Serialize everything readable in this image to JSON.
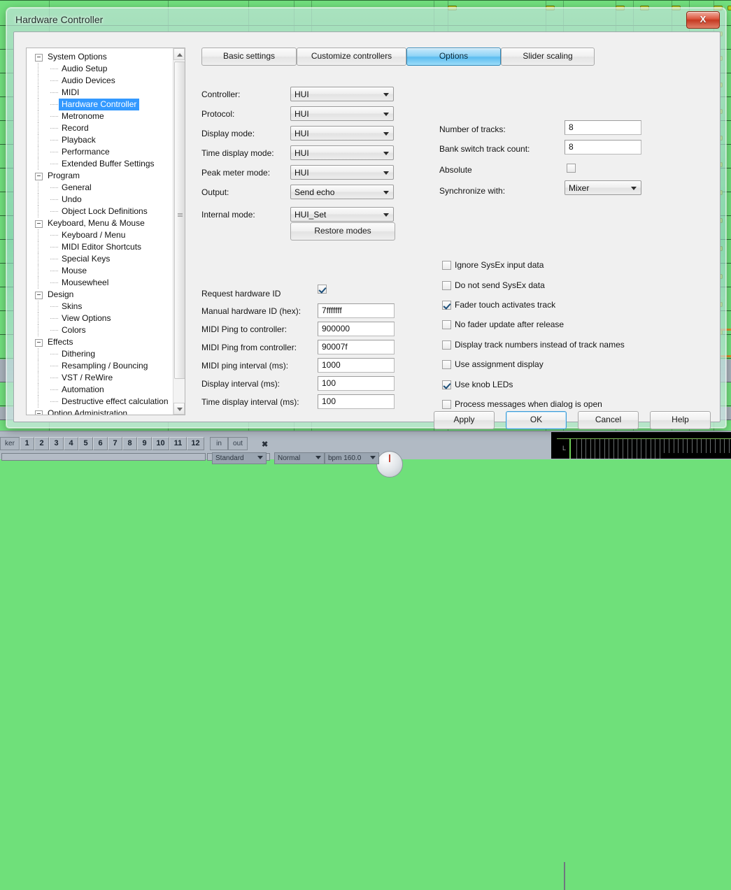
{
  "window": {
    "title": "Hardware Controller",
    "close_label": "X"
  },
  "tree": {
    "nodes": [
      {
        "label": "System Options",
        "level": 0,
        "expandable": true,
        "selected": false
      },
      {
        "label": "Audio Setup",
        "level": 1,
        "expandable": false,
        "selected": false
      },
      {
        "label": "Audio Devices",
        "level": 1,
        "expandable": false,
        "selected": false
      },
      {
        "label": "MIDI",
        "level": 1,
        "expandable": false,
        "selected": false
      },
      {
        "label": "Hardware Controller",
        "level": 1,
        "expandable": false,
        "selected": true
      },
      {
        "label": "Metronome",
        "level": 1,
        "expandable": false,
        "selected": false
      },
      {
        "label": "Record",
        "level": 1,
        "expandable": false,
        "selected": false
      },
      {
        "label": "Playback",
        "level": 1,
        "expandable": false,
        "selected": false
      },
      {
        "label": "Performance",
        "level": 1,
        "expandable": false,
        "selected": false
      },
      {
        "label": "Extended Buffer Settings",
        "level": 1,
        "expandable": false,
        "selected": false
      },
      {
        "label": "Program",
        "level": 0,
        "expandable": true,
        "selected": false
      },
      {
        "label": "General",
        "level": 1,
        "expandable": false,
        "selected": false
      },
      {
        "label": "Undo",
        "level": 1,
        "expandable": false,
        "selected": false
      },
      {
        "label": "Object Lock Definitions",
        "level": 1,
        "expandable": false,
        "selected": false
      },
      {
        "label": "Keyboard, Menu & Mouse",
        "level": 0,
        "expandable": true,
        "selected": false
      },
      {
        "label": "Keyboard / Menu",
        "level": 1,
        "expandable": false,
        "selected": false
      },
      {
        "label": "MIDI Editor Shortcuts",
        "level": 1,
        "expandable": false,
        "selected": false
      },
      {
        "label": "Special Keys",
        "level": 1,
        "expandable": false,
        "selected": false
      },
      {
        "label": "Mouse",
        "level": 1,
        "expandable": false,
        "selected": false
      },
      {
        "label": "Mousewheel",
        "level": 1,
        "expandable": false,
        "selected": false
      },
      {
        "label": "Design",
        "level": 0,
        "expandable": true,
        "selected": false
      },
      {
        "label": "Skins",
        "level": 1,
        "expandable": false,
        "selected": false
      },
      {
        "label": "View Options",
        "level": 1,
        "expandable": false,
        "selected": false
      },
      {
        "label": "Colors",
        "level": 1,
        "expandable": false,
        "selected": false
      },
      {
        "label": "Effects",
        "level": 0,
        "expandable": true,
        "selected": false
      },
      {
        "label": "Dithering",
        "level": 1,
        "expandable": false,
        "selected": false
      },
      {
        "label": "Resampling / Bouncing",
        "level": 1,
        "expandable": false,
        "selected": false
      },
      {
        "label": "VST / ReWire",
        "level": 1,
        "expandable": false,
        "selected": false
      },
      {
        "label": "Automation",
        "level": 1,
        "expandable": false,
        "selected": false
      },
      {
        "label": "Destructive effect calculation",
        "level": 1,
        "expandable": false,
        "selected": false
      },
      {
        "label": "Option Administration",
        "level": 0,
        "expandable": true,
        "selected": false
      }
    ]
  },
  "tabs": [
    {
      "label": "Basic settings",
      "active": false
    },
    {
      "label": "Customize controllers",
      "active": false
    },
    {
      "label": "Options",
      "active": true
    },
    {
      "label": "Slider scaling",
      "active": false
    }
  ],
  "left_combos": [
    {
      "label": "Controller:",
      "value": "HUI"
    },
    {
      "label": "Protocol:",
      "value": "HUI"
    },
    {
      "label": "Display mode:",
      "value": "HUI"
    },
    {
      "label": "Time display mode:",
      "value": "HUI"
    },
    {
      "label": "Peak meter mode:",
      "value": "HUI"
    },
    {
      "label": "Output:",
      "value": "Send echo"
    },
    {
      "label": "Internal mode:",
      "value": "HUI_Set"
    }
  ],
  "restore_button": "Restore modes",
  "request_hardware_id": {
    "label": "Request hardware ID",
    "checked": true
  },
  "left_inputs": [
    {
      "label": "Manual hardware ID (hex):",
      "value": "7fffffff"
    },
    {
      "label": "MIDI Ping to controller:",
      "value": "900000"
    },
    {
      "label": "MIDI Ping from controller:",
      "value": "90007f"
    },
    {
      "label": "MIDI ping interval (ms):",
      "value": "1000"
    },
    {
      "label": "Display interval (ms):",
      "value": "100"
    },
    {
      "label": "Time display interval (ms):",
      "value": "100"
    }
  ],
  "right_fields": {
    "number_of_tracks": {
      "label": "Number of tracks:",
      "value": "8"
    },
    "bank_switch_track_count": {
      "label": "Bank switch track count:",
      "value": "8"
    },
    "absolute": {
      "label": "Absolute",
      "checked": false
    },
    "synchronize_with": {
      "label": "Synchronize with:",
      "value": "Mixer"
    }
  },
  "right_checkboxes": [
    {
      "label": "Ignore SysEx input data",
      "checked": false
    },
    {
      "label": "Do not send SysEx data",
      "checked": false
    },
    {
      "label": "Fader touch activates track",
      "checked": true
    },
    {
      "label": "No fader update after release",
      "checked": false
    },
    {
      "label": "Display track numbers instead of track names",
      "checked": false
    },
    {
      "label": "Use assignment display",
      "checked": false
    },
    {
      "label": "Use knob LEDs",
      "checked": true
    },
    {
      "label": "Process messages when dialog is open",
      "checked": false
    }
  ],
  "action_buttons": [
    {
      "label": "Apply",
      "default": false
    },
    {
      "label": "OK",
      "default": true
    },
    {
      "label": "Cancel",
      "default": false
    },
    {
      "label": "Help",
      "default": false
    }
  ],
  "bottom_strip": {
    "marker_label": "ker",
    "track_numbers": [
      "1",
      "2",
      "3",
      "4",
      "5",
      "6",
      "7",
      "8",
      "9",
      "10",
      "11",
      "12"
    ],
    "in_label": "in",
    "out_label": "out",
    "close_glyph": "✖",
    "standard_dropdown": "Standard",
    "normal_dropdown": "Normal",
    "bpm_dropdown": "bpm  160.0",
    "meter_left_label": "L"
  },
  "colors": {
    "accent_blue": "#3399ff",
    "tab_active": "#5bbdf0",
    "close_red": "#c53a22",
    "daw_green": "#72e07e"
  }
}
